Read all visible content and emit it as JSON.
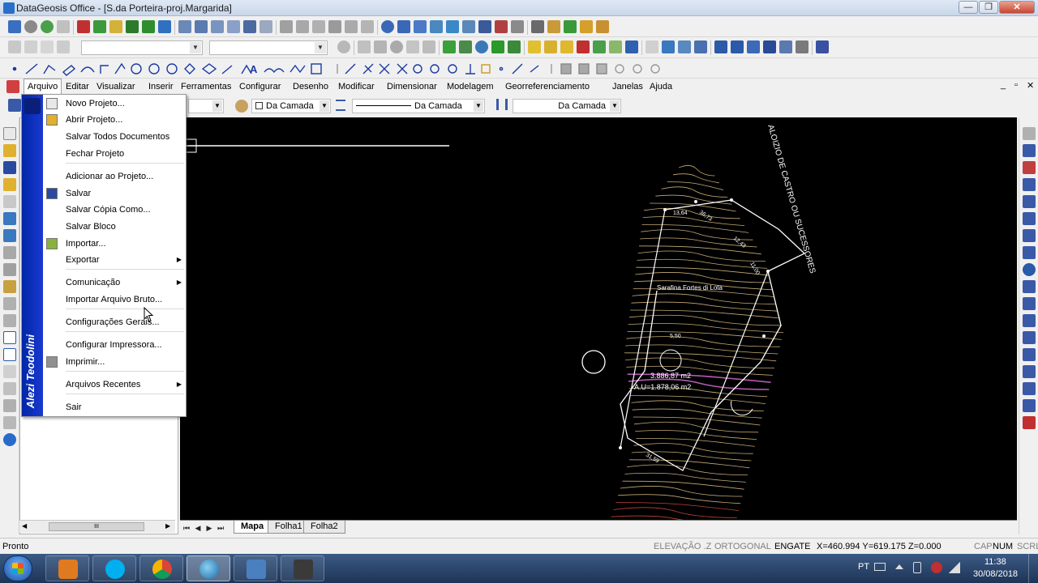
{
  "window": {
    "title": "DataGeosis Office - [S.da Porteira-proj.Margarida]",
    "minimize_glyph": "—",
    "restore_glyph": "❐",
    "close_glyph": "✕"
  },
  "toolbar3": {
    "text_tool_glyph": "A"
  },
  "menubar": {
    "items": [
      {
        "label": "Arquivo"
      },
      {
        "label": "Editar"
      },
      {
        "label": "Visualizar"
      },
      {
        "label": "Inserir"
      },
      {
        "label": "Ferramentas"
      },
      {
        "label": "Configurar"
      },
      {
        "label": "Desenho"
      },
      {
        "label": "Modificar"
      },
      {
        "label": "Dimensionar"
      },
      {
        "label": "Modelagem"
      },
      {
        "label": "Georreferenciamento"
      },
      {
        "label": "Janelas"
      },
      {
        "label": "Ajuda"
      }
    ],
    "doc_minimize_glyph": "_",
    "doc_restore_glyph": "▫",
    "doc_close_glyph": "✕"
  },
  "properties": {
    "color_value": "Da Camada",
    "linetype_value": "Da Camada",
    "lineweight_value": "Da Camada"
  },
  "file_menu": {
    "banner": "Alezi Teodolini",
    "items": [
      {
        "label": "Novo Projeto...",
        "icon": "new-project-icon"
      },
      {
        "label": "Abrir Projeto...",
        "icon": "open-folder-icon"
      },
      {
        "label": "Salvar Todos Documentos",
        "icon": ""
      },
      {
        "label": "Fechar Projeto",
        "icon": ""
      },
      {
        "label": "Adicionar ao Projeto...",
        "icon": ""
      },
      {
        "label": "Salvar",
        "icon": "save-icon"
      },
      {
        "label": "Salvar Cópia Como...",
        "icon": ""
      },
      {
        "label": "Salvar Bloco",
        "icon": ""
      },
      {
        "label": "Importar...",
        "icon": "import-folder-icon"
      },
      {
        "label": "Exportar",
        "icon": "",
        "submenu": true
      },
      {
        "label": "Comunicação",
        "icon": "",
        "submenu": true
      },
      {
        "label": "Importar Arquivo Bruto...",
        "icon": ""
      },
      {
        "label": "Configurações Gerais...",
        "icon": ""
      },
      {
        "label": "Configurar Impressora...",
        "icon": ""
      },
      {
        "label": "Imprimir...",
        "icon": "printer-icon"
      },
      {
        "label": "Arquivos Recentes",
        "icon": "",
        "submenu": true
      },
      {
        "label": "Sair",
        "icon": ""
      }
    ],
    "submenu_glyph": "▶"
  },
  "drawing": {
    "owner_label": "ALOIZIO DE CASTRO OU SUCESSORES",
    "road_label": "Sarafina Fortes di Lota",
    "area_label": "3.886,87 m2",
    "useful_area_label": "A.U=1.878,06 m2",
    "dim_top": "13,64",
    "dim_top2": "36,73",
    "dim_right": "12,43",
    "dim_right2": "11,00",
    "dim_mid": "5,50",
    "dim_bottom": "31,59"
  },
  "sheets": {
    "tabs": [
      {
        "label": "Mapa",
        "active": true
      },
      {
        "label": "Folha1",
        "active": false
      },
      {
        "label": "Folha2",
        "active": false
      }
    ],
    "nav_first": "⏮",
    "nav_prev": "◀",
    "nav_next": "▶",
    "nav_last": "⏭"
  },
  "left_panel": {
    "scroll_left": "◀",
    "scroll_right": "▶",
    "scroll_grip": "III"
  },
  "statusbar": {
    "status": "Pronto",
    "elevation": "ELEVAÇÃO .Z",
    "ortho": "ORTOGONAL",
    "snap": "ENGATE",
    "coords": "X=460.994 Y=619.175 Z=0.000",
    "caps": "CAP",
    "num": "NUM",
    "scrl": "SCRL"
  },
  "taskbar": {
    "language": "PT",
    "time": "11:38",
    "date": "30/08/2018"
  },
  "colors": {
    "banner": "#0026a8",
    "contour": "#e8c88a",
    "contour_accent": "#d06ad0",
    "contour_red": "#e05040",
    "boundary": "#ffffff"
  }
}
